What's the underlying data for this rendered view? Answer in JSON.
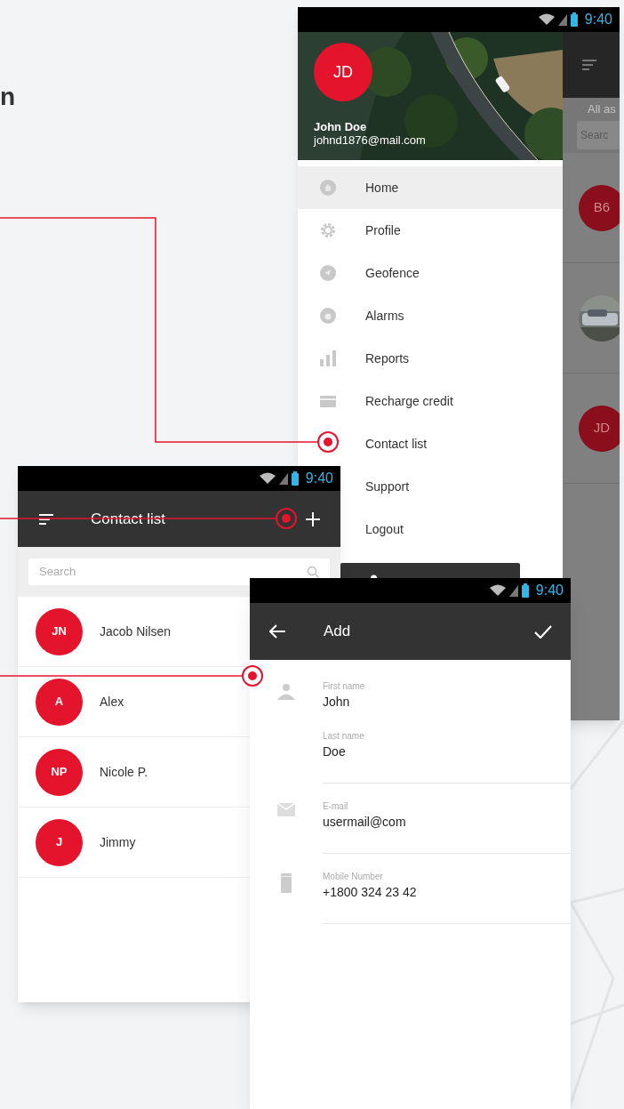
{
  "heading_fragment": "n",
  "drawer_screen": {
    "status_time": "9:40",
    "user": {
      "initials": "JD",
      "name": "John Doe",
      "email": "johnd1876@mail.com"
    },
    "menu": [
      {
        "label": "Home",
        "selected": true
      },
      {
        "label": "Profile",
        "selected": false
      },
      {
        "label": "Geofence",
        "selected": false
      },
      {
        "label": "Alarms",
        "selected": false
      },
      {
        "label": "Reports",
        "selected": false
      },
      {
        "label": "Recharge credit",
        "selected": false
      },
      {
        "label": "Contact list",
        "selected": false
      },
      {
        "label": "Support",
        "selected": false
      },
      {
        "label": "Logout",
        "selected": false
      }
    ],
    "behind": {
      "filter_label": "All as",
      "search_placeholder": "Searc",
      "items": [
        {
          "kind": "initials",
          "text": "B6"
        },
        {
          "kind": "picture"
        },
        {
          "kind": "initials",
          "text": "JD"
        }
      ]
    }
  },
  "contact_list_screen": {
    "status_time": "9:40",
    "title": "Contact list",
    "search_placeholder": "Search",
    "contacts": [
      {
        "initials": "JN",
        "name": "Jacob Nilsen"
      },
      {
        "initials": "A",
        "name": "Alex"
      },
      {
        "initials": "NP",
        "name": "Nicole P."
      },
      {
        "initials": "J",
        "name": "Jimmy"
      }
    ]
  },
  "add_screen": {
    "status_time": "9:40",
    "title": "Add",
    "fields": [
      {
        "label": "First name",
        "value": "John"
      },
      {
        "label": "Last name",
        "value": "Doe"
      },
      {
        "label": "E-mail",
        "value": "usermail@com"
      },
      {
        "label": "Mobile Number",
        "value": "+1800 324 23 42"
      }
    ]
  }
}
